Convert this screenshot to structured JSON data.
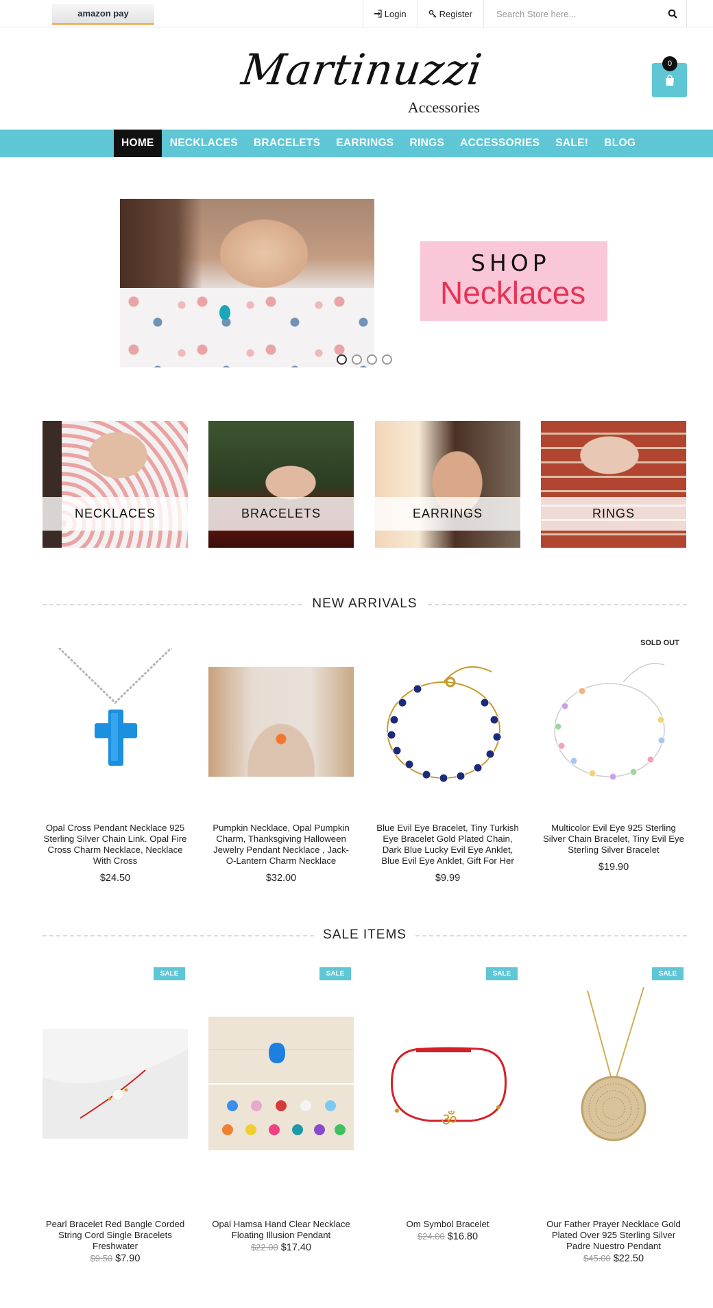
{
  "topbar": {
    "amazon_pay": "amazon pay",
    "login": "Login",
    "register": "Register",
    "search_placeholder": "Search Store here..."
  },
  "header": {
    "logo_main": "Martinuzzi",
    "logo_sub": "Accessories",
    "cart_count": "0"
  },
  "nav": {
    "items": [
      "HOME",
      "NECKLACES",
      "BRACELETS",
      "EARRINGS",
      "RINGS",
      "ACCESSORIES",
      "SALE!",
      "BLOG"
    ]
  },
  "slider": {
    "banner_shop": "SHOP",
    "banner_category": "Necklaces"
  },
  "categories": [
    "NECKLACES",
    "BRACELETS",
    "EARRINGS",
    "RINGS"
  ],
  "new_arrivals": {
    "title": "NEW ARRIVALS",
    "products": [
      {
        "name": "Opal Cross Pendant Necklace 925 Sterling Silver Chain Link. Opal Fire Cross Charm Necklace, Necklace With Cross",
        "price": "$24.50"
      },
      {
        "name": "Pumpkin Necklace, Opal Pumpkin Charm, Thanksgiving Halloween Jewelry Pendant Necklace , Jack-O-Lantern Charm Necklace",
        "price": "$32.00"
      },
      {
        "name": "Blue Evil Eye Bracelet, Tiny Turkish Eye Bracelet Gold Plated Chain, Dark Blue Lucky Evil Eye Anklet, Blue Evil Eye Anklet, Gift For Her",
        "price": "$9.99"
      },
      {
        "name": "Multicolor Evil Eye 925 Sterling Silver Chain Bracelet, Tiny Evil Eye Sterling Silver Bracelet",
        "price": "$19.90",
        "badge": "SOLD OUT"
      }
    ]
  },
  "sale_items": {
    "title": "SALE ITEMS",
    "badge": "SALE",
    "products": [
      {
        "name": "Pearl Bracelet Red Bangle Corded String Cord Single Bracelets Freshwater",
        "old_price": "$9.50",
        "price": "$7.90"
      },
      {
        "name": "Opal Hamsa Hand Clear Necklace Floating Illusion Pendant",
        "old_price": "$22.00",
        "price": "$17.40"
      },
      {
        "name": "Om Symbol Bracelet",
        "old_price": "$24.00",
        "price": "$16.80"
      },
      {
        "name": "Our Father Prayer Necklace Gold Plated Over 925 Sterling Silver Padre Nuestro Pendant",
        "old_price": "$45.00",
        "price": "$22.50"
      }
    ],
    "hamsa_colors": [
      "BLUE",
      "PINK",
      "RED",
      "WHITE",
      "LIGHT BLUE",
      "ORANGE",
      "YELLOW",
      "HOT PINK",
      "PEACOCK BLUE",
      "PURPLE",
      "GREEN"
    ]
  },
  "colors": {
    "accent": "#5ec6d4",
    "nav_active": "#111111",
    "banner_pink": "#fac7d9",
    "banner_text": "#e73355"
  }
}
